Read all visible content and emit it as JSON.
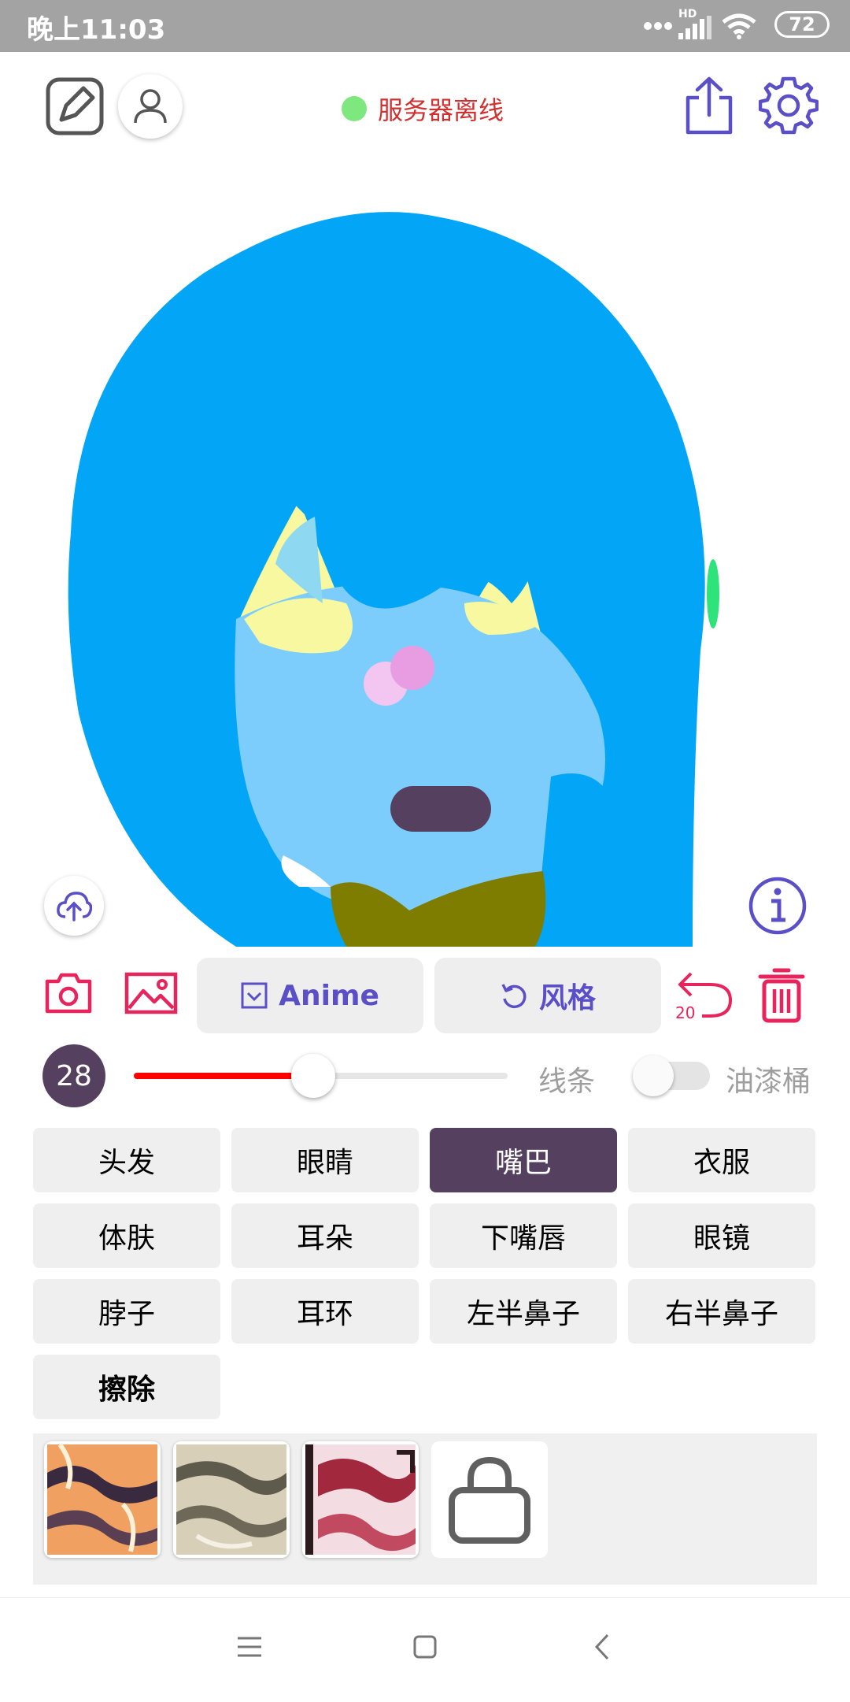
{
  "status_bar": {
    "time": "晚上11:03",
    "battery": "72",
    "network_label": "HD"
  },
  "top_bar": {
    "server_status": "服务器离线",
    "server_status_color": "#7ee87e"
  },
  "toolbar": {
    "anime_label": "Anime",
    "style_label": "风格",
    "undo_count": "20"
  },
  "brush": {
    "size": "28",
    "slider_level_percent": 48,
    "lines_label": "线条",
    "bucket_label": "油漆桶",
    "bucket_enabled": false
  },
  "parts": [
    {
      "label": "头发"
    },
    {
      "label": "眼睛"
    },
    {
      "label": "嘴巴",
      "selected": true
    },
    {
      "label": "衣服"
    },
    {
      "label": "体肤"
    },
    {
      "label": "耳朵"
    },
    {
      "label": "下嘴唇"
    },
    {
      "label": "眼镜"
    },
    {
      "label": "脖子"
    },
    {
      "label": "耳环"
    },
    {
      "label": "左半鼻子"
    },
    {
      "label": "右半鼻子"
    },
    {
      "label": "擦除"
    }
  ],
  "textures": [
    "texture-orange",
    "texture-grey",
    "texture-crimson",
    "shop-bag-icon"
  ],
  "colors": {
    "accent": "#5a4fc6",
    "red_accent": "#e8245c",
    "selected_part": "#56405f",
    "slider_fill": "#ff0000",
    "hair": "#03a6f6",
    "skin": "#7ccdfb"
  }
}
